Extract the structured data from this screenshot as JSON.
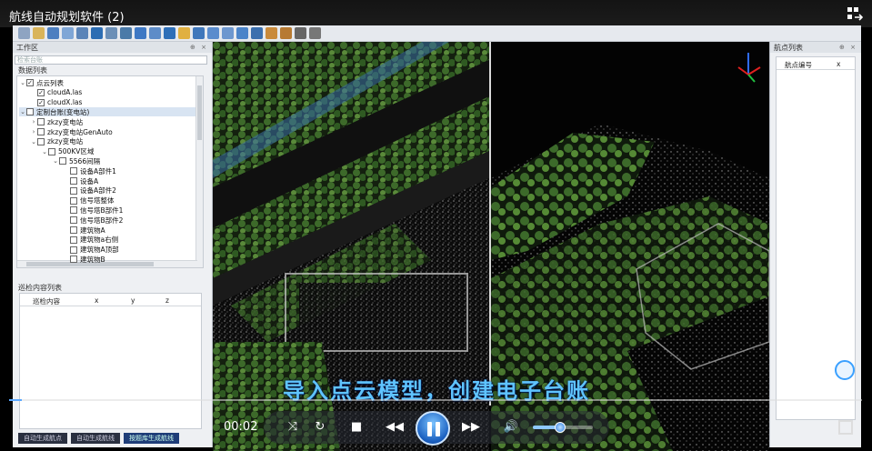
{
  "window": {
    "title": "航线自动规划软件 (2)"
  },
  "left_panel": {
    "header": "工作区",
    "search_placeholder": "检索台账",
    "data_list_label": "数据列表",
    "tree": [
      {
        "label": "点云列表",
        "level": 0,
        "expanded": true,
        "checked": true,
        "selected": false
      },
      {
        "label": "cloudA.las",
        "level": 1,
        "expanded": null,
        "checked": true,
        "selected": false
      },
      {
        "label": "cloudX.las",
        "level": 1,
        "expanded": null,
        "checked": true,
        "selected": false
      },
      {
        "label": "定制台账(变电站)",
        "level": 0,
        "expanded": true,
        "checked": false,
        "selected": true
      },
      {
        "label": "zkzy变电站",
        "level": 1,
        "expanded": false,
        "checked": false,
        "selected": false
      },
      {
        "label": "zkzy变电站GenAuto",
        "level": 1,
        "expanded": false,
        "checked": false,
        "selected": false
      },
      {
        "label": "zkzy变电站",
        "level": 1,
        "expanded": true,
        "checked": false,
        "selected": false
      },
      {
        "label": "500KV区域",
        "level": 2,
        "expanded": true,
        "checked": false,
        "selected": false
      },
      {
        "label": "5566间隔",
        "level": 3,
        "expanded": true,
        "checked": false,
        "selected": false
      },
      {
        "label": "设备A部件1",
        "level": 4,
        "expanded": null,
        "checked": false,
        "selected": false
      },
      {
        "label": "设备A",
        "level": 4,
        "expanded": null,
        "checked": false,
        "selected": false
      },
      {
        "label": "设备A部件2",
        "level": 4,
        "expanded": null,
        "checked": false,
        "selected": false
      },
      {
        "label": "信号塔整体",
        "level": 4,
        "expanded": null,
        "checked": false,
        "selected": false
      },
      {
        "label": "信号塔B部件1",
        "level": 4,
        "expanded": null,
        "checked": false,
        "selected": false
      },
      {
        "label": "信号塔B部件2",
        "level": 4,
        "expanded": null,
        "checked": false,
        "selected": false
      },
      {
        "label": "建筑物A",
        "level": 4,
        "expanded": null,
        "checked": false,
        "selected": false
      },
      {
        "label": "建筑物a右侧",
        "level": 4,
        "expanded": null,
        "checked": false,
        "selected": false
      },
      {
        "label": "建筑物A顶部",
        "level": 4,
        "expanded": null,
        "checked": false,
        "selected": false
      },
      {
        "label": "建筑物B",
        "level": 4,
        "expanded": null,
        "checked": false,
        "selected": false
      }
    ],
    "inspect_label": "巡检内容列表",
    "inspect_columns": [
      "巡检内容",
      "x",
      "y",
      "z"
    ],
    "bottom_tabs": [
      "自动生成航点",
      "自动生成航线",
      "按题库生成航线"
    ]
  },
  "right_panel": {
    "header": "航点列表",
    "columns": [
      "航点编号",
      "x"
    ]
  },
  "player": {
    "subtitle": "导入点云模型，创建电子台账",
    "time": "00:02",
    "progress": 0.015,
    "volume": 0.45,
    "state": "playing"
  },
  "colors": {
    "accent": "#1a5fbf",
    "subtitle": "#5fc4ff",
    "panel_bg": "#eef0f3"
  }
}
